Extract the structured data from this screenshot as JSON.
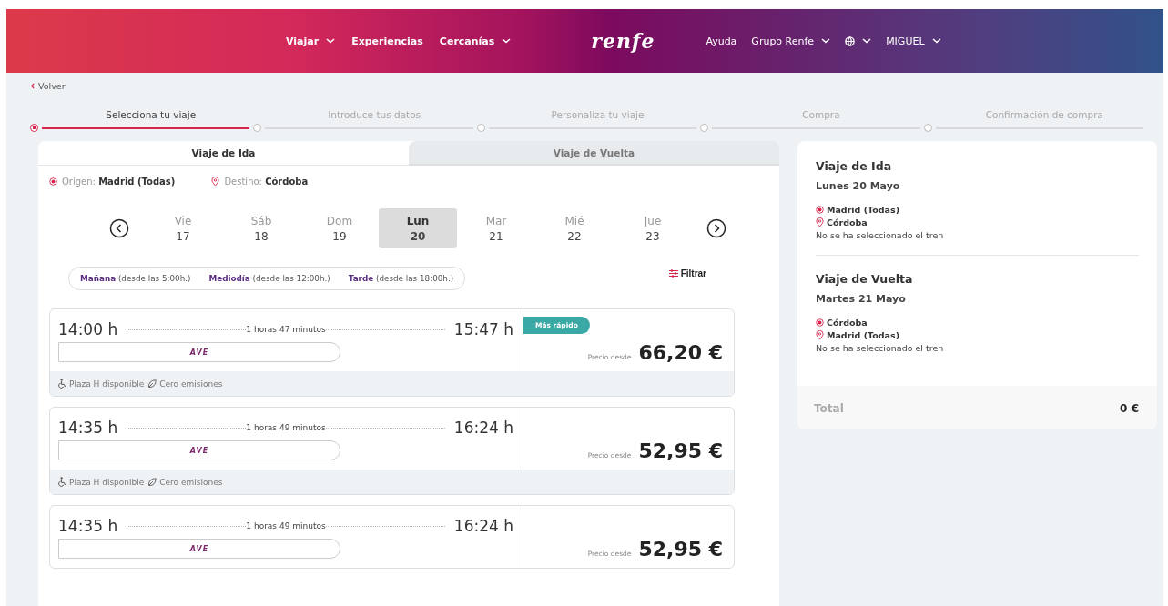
{
  "header": {
    "nav_left": [
      {
        "label": "Viajar",
        "dropdown": true
      },
      {
        "label": "Experiencias",
        "dropdown": false
      },
      {
        "label": "Cercanías",
        "dropdown": true
      }
    ],
    "logo": "renfe",
    "nav_right": [
      {
        "label": "Ayuda",
        "dropdown": false
      },
      {
        "label": "Grupo Renfe",
        "dropdown": true
      },
      {
        "kind": "globe",
        "dropdown": true
      },
      {
        "label": "MIGUEL",
        "dropdown": true
      }
    ]
  },
  "back_link": "Volver",
  "steps": [
    {
      "label": "Selecciona tu viaje",
      "selected": true
    },
    {
      "label": "Introduce tus datos",
      "selected": false
    },
    {
      "label": "Personaliza tu viaje",
      "selected": false
    },
    {
      "label": "Compra",
      "selected": false
    },
    {
      "label": "Confirmación de compra",
      "selected": false
    }
  ],
  "tabs": [
    {
      "label": "Viaje de Ida",
      "selected": true
    },
    {
      "label": "Viaje de Vuelta",
      "selected": false
    }
  ],
  "route": {
    "origin_label": "Origen:",
    "origin": "Madrid (Todas)",
    "destination_label": "Destino:",
    "destination": "Córdoba"
  },
  "days": [
    {
      "weekday": "Vie",
      "day": "17",
      "selected": false
    },
    {
      "weekday": "Sáb",
      "day": "18",
      "selected": false
    },
    {
      "weekday": "Dom",
      "day": "19",
      "selected": false
    },
    {
      "weekday": "Lun",
      "day": "20",
      "selected": true
    },
    {
      "weekday": "Mar",
      "day": "21",
      "selected": false
    },
    {
      "weekday": "Mié",
      "day": "22",
      "selected": false
    },
    {
      "weekday": "Jue",
      "day": "23",
      "selected": false
    }
  ],
  "time_filters": [
    {
      "label": "Mañana",
      "hint": "(desde las 5:00h.)"
    },
    {
      "label": "Mediodía",
      "hint": "(desde las 12:00h.)"
    },
    {
      "label": "Tarde",
      "hint": "(desde las 18:00h.)"
    }
  ],
  "filter_button": "Filtrar",
  "trains": [
    {
      "departure": "14:00 h",
      "duration": "1 horas 47 minutos",
      "arrival": "15:47 h",
      "brand": "AVE",
      "badge": "Más rápido",
      "price_label": "Precio desde",
      "price": "66,20 €",
      "features": [
        "Plaza H disponible",
        "Cero emisiones"
      ]
    },
    {
      "departure": "14:35 h",
      "duration": "1 horas 49 minutos",
      "arrival": "16:24 h",
      "brand": "AVE",
      "price_label": "Precio desde",
      "price": "52,95 €",
      "features": [
        "Plaza H disponible",
        "Cero emisiones"
      ]
    },
    {
      "departure": "14:35 h",
      "duration": "1 horas 49 minutos",
      "arrival": "16:24 h",
      "brand": "AVE",
      "price_label": "Precio desde",
      "price": "52,95 €"
    }
  ],
  "summary": {
    "trips": [
      {
        "title": "Viaje de Ida",
        "date": "Lunes 20 Mayo",
        "origin": "Madrid (Todas)",
        "destination": "Córdoba",
        "status": "No se ha seleccionado el tren"
      },
      {
        "title": "Viaje de Vuelta",
        "date": "Martes 21 Mayo",
        "origin": "Córdoba",
        "destination": "Madrid (Todas)",
        "status": "No se ha seleccionado el tren"
      }
    ],
    "total_label": "Total",
    "total": "0 €"
  }
}
